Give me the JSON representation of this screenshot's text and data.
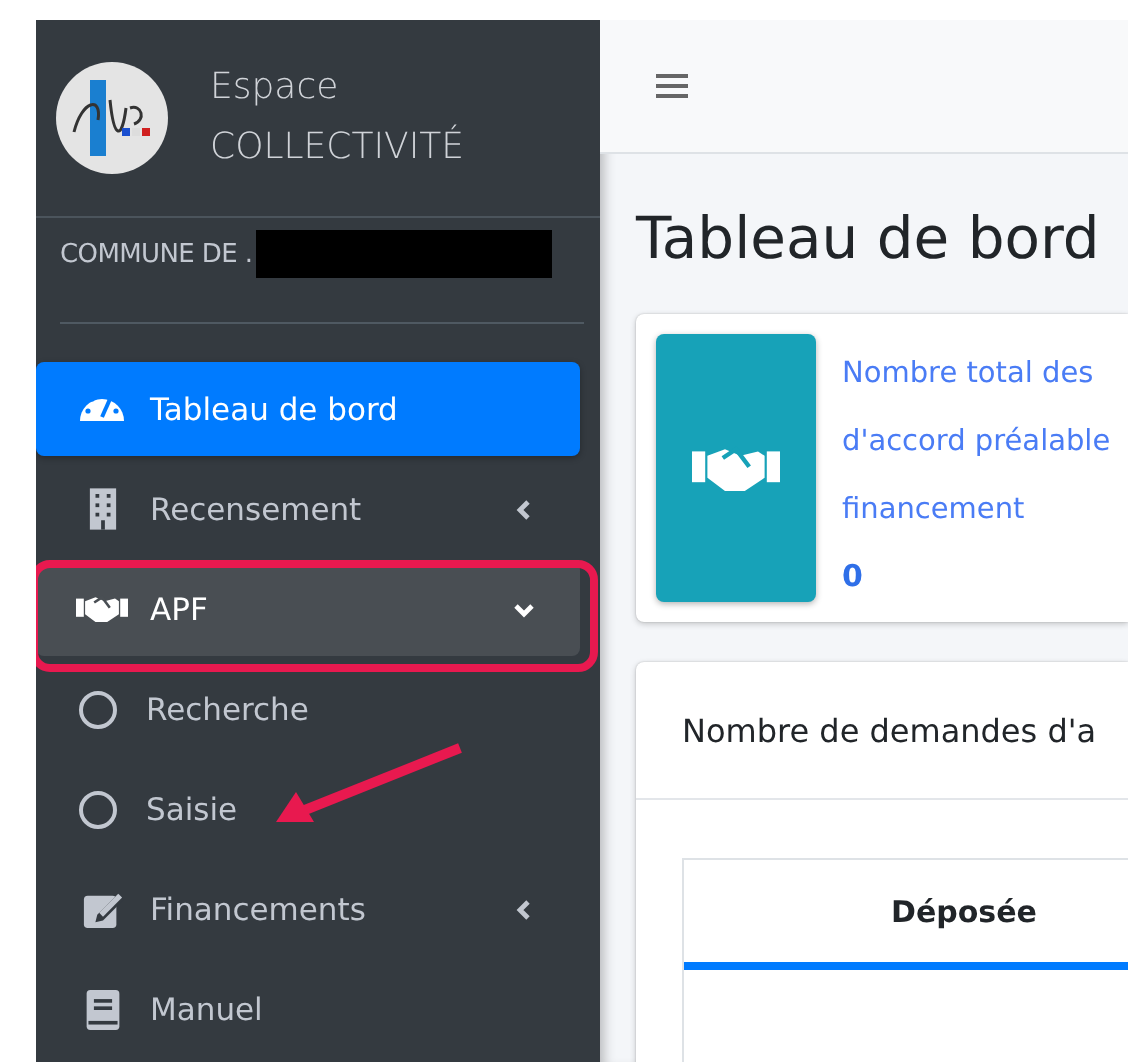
{
  "brand": {
    "line_1": "Espace",
    "line_2": "COLLECTIVITÉ"
  },
  "user": {
    "name": "COMMUNE DE ."
  },
  "nav": [
    {
      "label": "Tableau de bord",
      "kind": "link",
      "selected": true,
      "expanded": false
    },
    {
      "label": "Recensement",
      "kind": "parent",
      "selected": false,
      "expanded": false
    },
    {
      "label": "APF",
      "kind": "parent",
      "selected": false,
      "expanded": true
    },
    {
      "label": "Recherche",
      "kind": "subitem",
      "selected": false,
      "expanded": false
    },
    {
      "label": "Saisie",
      "kind": "subitem",
      "selected": false,
      "expanded": false
    },
    {
      "label": "Financements",
      "kind": "parent",
      "selected": false,
      "expanded": false
    },
    {
      "label": "Manuel",
      "kind": "link",
      "selected": false,
      "expanded": false
    }
  ],
  "page_title": "Tableau de bord",
  "info_box": {
    "text_lines": [
      "Nombre total des",
      "d'accord préalable",
      "financement"
    ],
    "value": "0"
  },
  "panel": {
    "title": "Nombre de demandes d'a",
    "table": {
      "columns": [
        "Déposée"
      ]
    }
  }
}
